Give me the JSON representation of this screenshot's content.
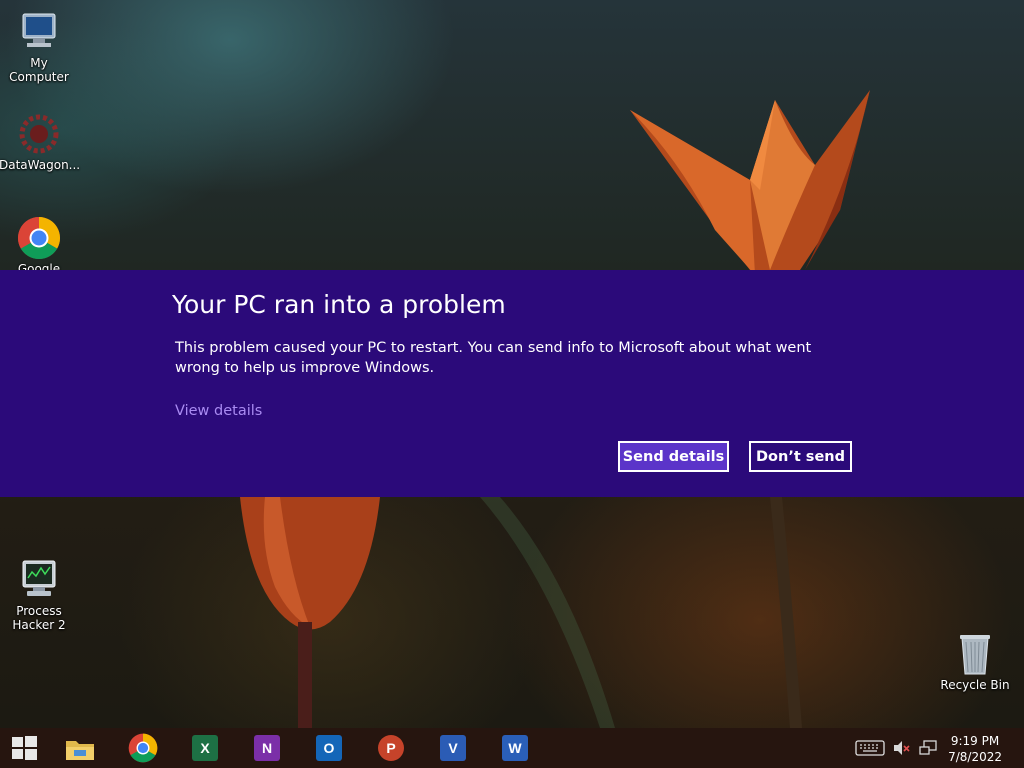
{
  "desktop": {
    "icons": [
      {
        "label": "My Computer",
        "icon": "computer-icon"
      },
      {
        "label": "DataWagon...",
        "icon": "datawagon-icon"
      },
      {
        "label": "Google Chrome",
        "icon": "chrome-icon"
      },
      {
        "label": "Process\nHacker 2",
        "icon": "process-hacker-icon"
      },
      {
        "label": "Recycle Bin",
        "icon": "recycle-bin-icon"
      }
    ]
  },
  "dialog": {
    "title": "Your PC ran into a problem",
    "message": "This problem caused your PC to restart. You can send info to Microsoft about what went wrong to help us improve Windows.",
    "view_details": "View details",
    "send_button": "Send details",
    "dont_send_button": "Don’t send",
    "background_color": "#2b0a7a",
    "accent_color": "#5b34c9"
  },
  "taskbar": {
    "apps": [
      {
        "name": "start",
        "icon": "windows-logo-icon"
      },
      {
        "name": "file-explorer",
        "icon": "folder-icon"
      },
      {
        "name": "chrome",
        "icon": "chrome-icon"
      },
      {
        "name": "excel",
        "icon": "excel-icon",
        "letter": "X",
        "color": "#1d7044"
      },
      {
        "name": "onenote",
        "icon": "onenote-icon",
        "letter": "N",
        "color": "#7b2fa8"
      },
      {
        "name": "outlook",
        "icon": "outlook-icon",
        "letter": "O",
        "color": "#1466b8"
      },
      {
        "name": "powerpoint",
        "icon": "powerpoint-icon",
        "letter": "P",
        "color": "#c6432a"
      },
      {
        "name": "visio",
        "icon": "visio-icon",
        "letter": "V",
        "color": "#2b5cb5"
      },
      {
        "name": "word",
        "icon": "word-icon",
        "letter": "W",
        "color": "#2a5fb8"
      }
    ],
    "tray": {
      "time": "9:19 PM",
      "date": "7/8/2022",
      "icons": [
        "keyboard-icon",
        "volume-muted-icon",
        "network-icon"
      ]
    }
  }
}
